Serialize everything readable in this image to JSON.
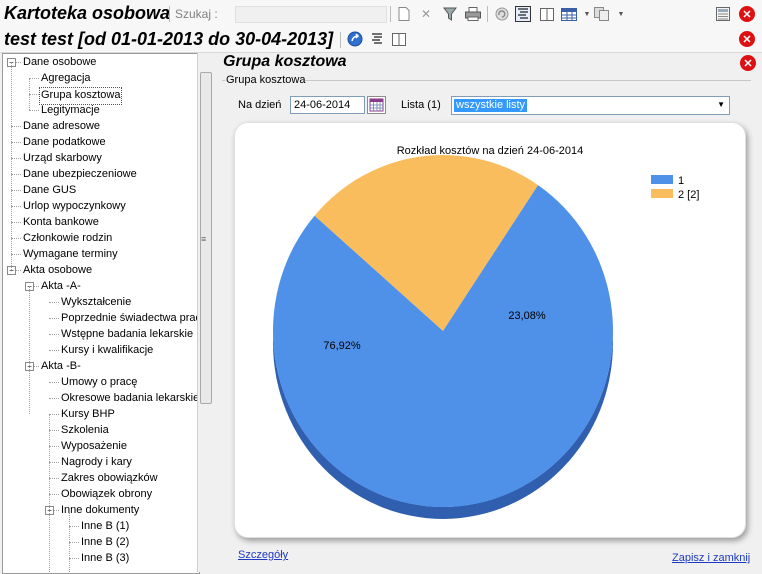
{
  "app": {
    "title": "Kartoteka osobowa",
    "search_label": "Szukaj :",
    "search_value": "",
    "subtitle": "test test [od 01-01-2013 do 30-04-2013]"
  },
  "toolbar_icons": [
    "new-document-icon",
    "delete-icon",
    "filter-icon",
    "print-icon",
    "refresh-icon",
    "form-view-icon",
    "split-view-icon",
    "grid-view-icon",
    "copy-icon",
    "calculator-icon",
    "close-icon"
  ],
  "tree": {
    "items": [
      {
        "label": "Dane osobowe",
        "level": 0,
        "toggle": "−"
      },
      {
        "label": "Agregacja",
        "level": 1
      },
      {
        "label": "Grupa kosztowa",
        "level": 1
      },
      {
        "label": "Legitymacje",
        "level": 1
      },
      {
        "label": "Dane adresowe",
        "level": 0
      },
      {
        "label": "Dane podatkowe",
        "level": 0
      },
      {
        "label": "Urząd skarbowy",
        "level": 0
      },
      {
        "label": "Dane ubezpieczeniowe",
        "level": 0
      },
      {
        "label": "Dane GUS",
        "level": 0
      },
      {
        "label": "Urlop wypoczynkowy",
        "level": 0
      },
      {
        "label": "Konta bankowe",
        "level": 0
      },
      {
        "label": "Członkowie rodzin",
        "level": 0
      },
      {
        "label": "Wymagane terminy",
        "level": 0
      },
      {
        "label": "Akta osobowe",
        "level": 0,
        "toggle": "−"
      },
      {
        "label": "Akta -A-",
        "level": 1,
        "toggle": "−"
      },
      {
        "label": "Wykształcenie",
        "level": 2
      },
      {
        "label": "Poprzednie świadectwa prac",
        "level": 2
      },
      {
        "label": "Wstępne badania lekarskie",
        "level": 2
      },
      {
        "label": "Kursy i kwalifikacje",
        "level": 2
      },
      {
        "label": "Akta -B-",
        "level": 1,
        "toggle": "−"
      },
      {
        "label": "Umowy o pracę",
        "level": 2
      },
      {
        "label": "Okresowe badania lekarskie",
        "level": 2
      },
      {
        "label": "Kursy BHP",
        "level": 2
      },
      {
        "label": "Szkolenia",
        "level": 2
      },
      {
        "label": "Wyposażenie",
        "level": 2
      },
      {
        "label": "Nagrody i kary",
        "level": 2
      },
      {
        "label": "Zakres obowiązków",
        "level": 2
      },
      {
        "label": "Obowiązek obrony",
        "level": 2
      },
      {
        "label": "Inne dokumenty",
        "level": 2,
        "toggle": "−"
      },
      {
        "label": "Inne B (1)",
        "level": 3
      },
      {
        "label": "Inne B (2)",
        "level": 3
      },
      {
        "label": "Inne B (3)",
        "level": 3
      }
    ]
  },
  "pane": {
    "title": "Grupa kosztowa",
    "group_label": "Grupa kosztowa",
    "date_label": "Na dzień",
    "date_value": "24-06-2014",
    "list_label": "Lista (1)",
    "list_value": "wszystkie listy",
    "details_link": "Szczegóły",
    "save_close_link": "Zapisz i zamknij"
  },
  "colors": {
    "slice1": "#4f90e8",
    "slice2": "#f9bd5e",
    "close": "#d11111"
  },
  "chart_data": {
    "type": "pie",
    "title": "Rozkład kosztów na dzień 24-06-2014",
    "categories": [
      "1",
      "2 [2]"
    ],
    "values": [
      76.92,
      23.08
    ],
    "labels": [
      "76,92%",
      "23,08%"
    ],
    "legend": "top-right"
  }
}
